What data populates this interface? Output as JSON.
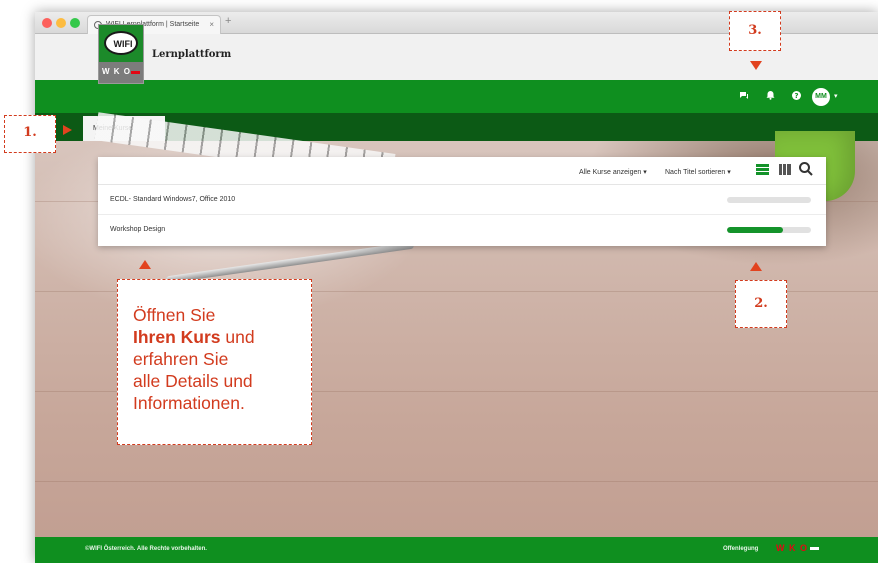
{
  "browser": {
    "tab_title": "WIFI Lernplattform | Startseite",
    "tab_close": "×",
    "new_tab": "+"
  },
  "header": {
    "brand_name": "Lernplattform",
    "logo_text": "WIFI",
    "logo_sub": "W K O"
  },
  "navbar": {
    "icons": [
      "chat-icon",
      "bell-icon",
      "help-icon"
    ],
    "avatar_initials": "MM",
    "avatar_caret": "▾"
  },
  "breadcrumb": {
    "item": "Meine Kurse"
  },
  "course_panel": {
    "filter_label": "Alle Kurse anzeigen",
    "sort_label": "Nach Titel sortieren",
    "caret": "▾",
    "courses": [
      {
        "title": "ECDL- Standard Windows7, Office 2010",
        "progress": 0
      },
      {
        "title": "Workshop Design",
        "progress": 67
      }
    ]
  },
  "footer": {
    "copyright": "©WIFI Österreich. Alle Rechte vorbehalten.",
    "impressum": "Offenlegung",
    "logo": "W K O"
  },
  "annotations": {
    "label_1": "1.",
    "label_2": "2.",
    "label_3": "3.",
    "info_line1": "Öffnen Sie",
    "info_bold": "Ihren Kurs",
    "info_line2_rest": " und",
    "info_line3": "erfahren Sie",
    "info_line4": "alle Details und",
    "info_line5": "Informationen."
  },
  "colors": {
    "brand_green": "#0f8f1f",
    "dark_green": "#0c5a15",
    "annotation_red": "#d23b1e"
  }
}
